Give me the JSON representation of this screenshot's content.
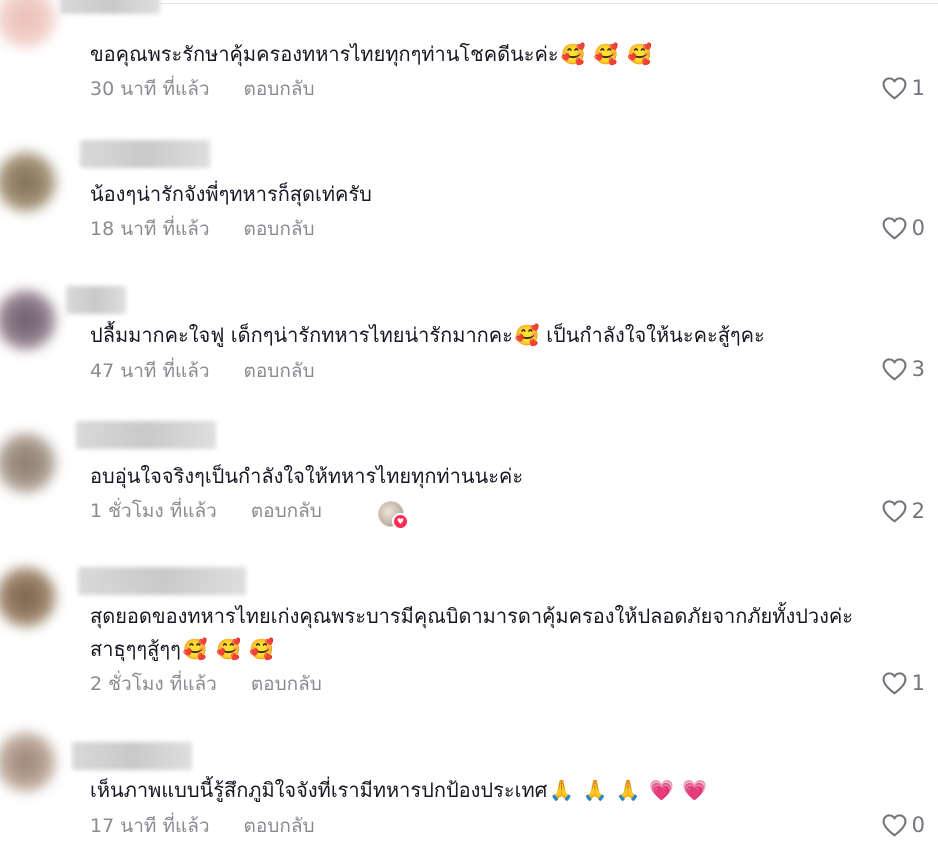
{
  "comments": [
    {
      "text": "ขอคุณพระรักษาคุ้มครองทหารไทยทุกๆท่านโชคดีนะค่ะ",
      "emojis": [
        "🥰",
        "🥰",
        "🥰"
      ],
      "time": "30 นาที ที่แล้ว",
      "reply": "ตอบกลับ",
      "likes": "1"
    },
    {
      "text": "น้องๆน่ารักจังพี่ๆทหารก็สุดเท่ครับ",
      "emojis": [],
      "time": "18 นาที ที่แล้ว",
      "reply": "ตอบกลับ",
      "likes": "0"
    },
    {
      "text": "ปลื้มมากคะใจฟู เด็กๆน่ารักทหารไทยน่ารักมากคะ",
      "emojis": [
        "🥰"
      ],
      "text2": "เป็นกำลังใจให้นะคะสู้ๆคะ",
      "time": "47 นาที ที่แล้ว",
      "reply": "ตอบกลับ",
      "likes": "3"
    },
    {
      "text": "อบอุ่นใจจริงๆเป็นกำลังใจให้ทหารไทยทุกท่านนะค่ะ",
      "emojis": [],
      "time": "1 ชั่วโมง ที่แล้ว",
      "reply": "ตอบกลับ",
      "likes": "2"
    },
    {
      "text": "สุดยอดของทหารไทยเก่งคุณพระบารมีคุณบิดามารดาคุ้มครองให้ปลอดภัยจากภัยทั้งปวงค่ะ",
      "text2": "สาธุๆๆสู้ๆๆ",
      "emojis": [
        "🥰",
        "🥰",
        "🥰"
      ],
      "time": "2 ชั่วโมง ที่แล้ว",
      "reply": "ตอบกลับ",
      "likes": "1"
    },
    {
      "text": "เห็นภาพแบบนี้รู้สึกภูมิใจจังที่เรามีทหารปกป้องประเทศ",
      "emojis": [
        "🙏",
        "🙏",
        "🙏",
        "💗",
        "💗"
      ],
      "time": "17 นาที ที่แล้ว",
      "reply": "ตอบกลับ",
      "likes": "0"
    }
  ],
  "icons": {
    "like": "heart-outline-icon",
    "creator_liked": "creator-liked-badge"
  },
  "colors": {
    "text": "#161823",
    "meta": "#8a8b91",
    "like_icon": "#73747b",
    "heart_emoji": "#ff2d6f"
  }
}
